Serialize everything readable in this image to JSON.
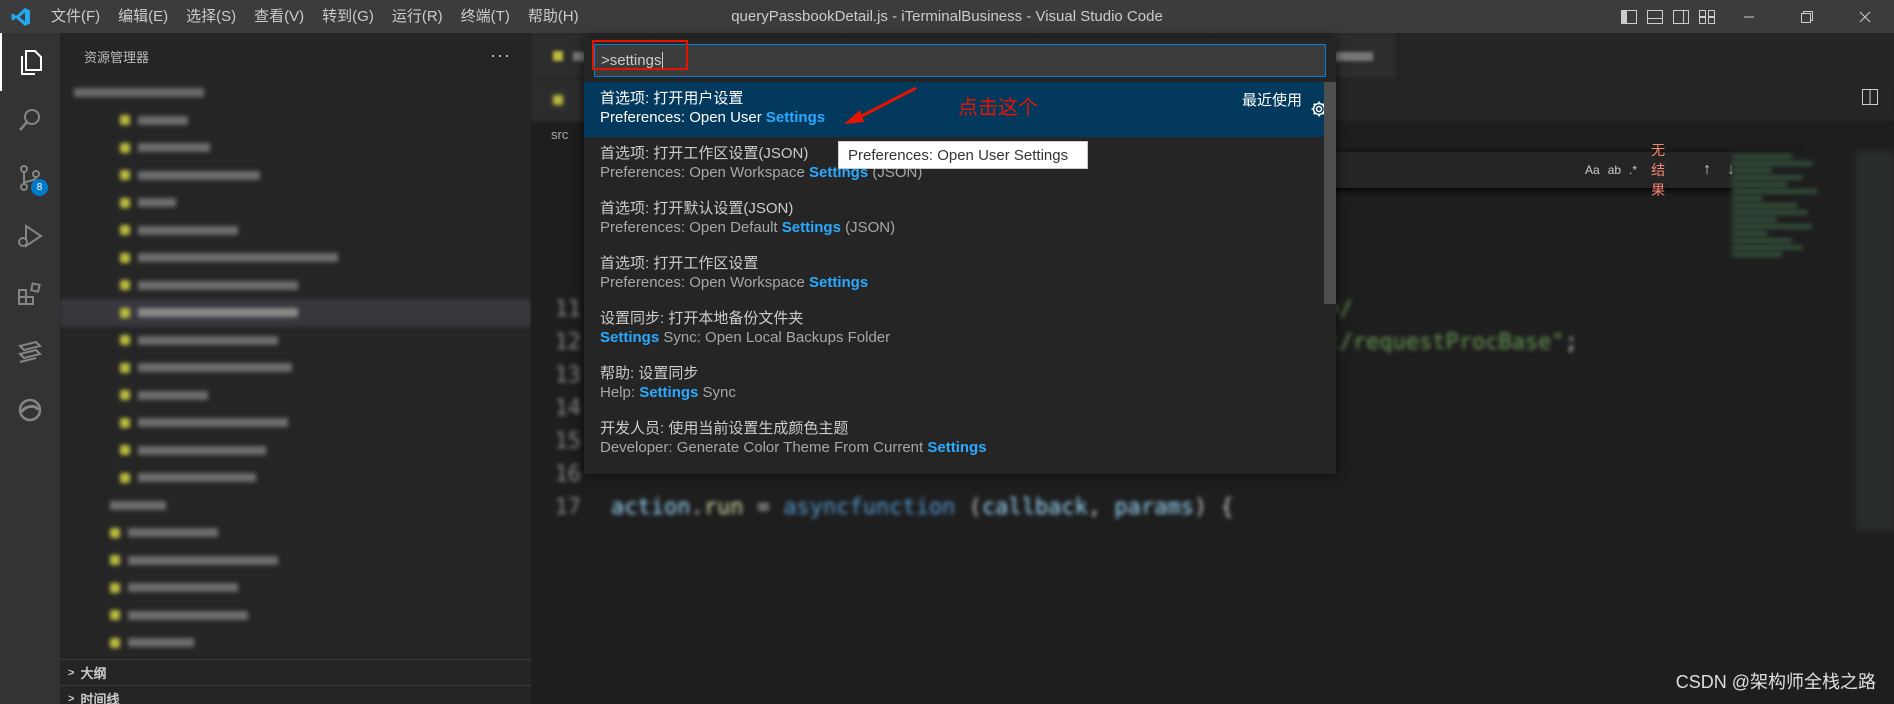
{
  "titlebar": {
    "menu": [
      "文件(F)",
      "编辑(E)",
      "选择(S)",
      "查看(V)",
      "转到(G)",
      "运行(R)",
      "终端(T)",
      "帮助(H)"
    ],
    "title": "queryPassbookDetail.js - iTerminalBusiness - Visual Studio Code"
  },
  "activitybar": {
    "scm_badge": "8"
  },
  "sidebar": {
    "header": "资源管理器",
    "more": "···",
    "sections": {
      "outline": "大纲",
      "timeline": "时间线"
    }
  },
  "editor": {
    "breadcrumb": "src",
    "tab_partial_right": "ssword"
  },
  "find": {
    "opt_case": "Aa",
    "opt_word": "ab",
    "opt_regex": ".*",
    "no_results": "无结果"
  },
  "palette": {
    "input_value": ">settings",
    "items": [
      {
        "label": "首选项: 打开用户设置",
        "detail_pre": "Preferences: Open User ",
        "detail_hl": "Settings",
        "detail_post": "",
        "recent": "最近使用"
      },
      {
        "label": "首选项: 打开工作区设置(JSON)",
        "detail_pre": "Preferences: Open Workspace ",
        "detail_hl": "Settings",
        "detail_post": " (JSON)"
      },
      {
        "label": "首选项: 打开默认设置(JSON)",
        "detail_pre": "Preferences: Open Default ",
        "detail_hl": "Settings",
        "detail_post": " (JSON)"
      },
      {
        "label": "首选项: 打开工作区设置",
        "detail_pre": "Preferences: Open Workspace ",
        "detail_hl": "Settings",
        "detail_post": ""
      },
      {
        "label": "设置同步: 打开本地备份文件夹",
        "detail_pre": "",
        "detail_hl": "Settings",
        "detail_post": " Sync: Open Local Backups Folder"
      },
      {
        "label": "帮助: 设置同步",
        "detail_pre": "Help: ",
        "detail_hl": "Settings",
        "detail_post": " Sync"
      },
      {
        "label": "开发人员: 使用当前设置生成颜色主题",
        "detail_pre": "Developer: Generate Color Theme From Current ",
        "detail_hl": "Settings",
        "detail_post": ""
      }
    ],
    "tooltip": "Preferences: Open User Settings"
  },
  "annotation": "点击这个",
  "watermark": "CSDN @架构师全栈之路",
  "colors": {
    "accent": "#007acc",
    "highlight": "#2aaaff",
    "focused_bg": "#04395e",
    "annotation_red": "#e51400"
  }
}
